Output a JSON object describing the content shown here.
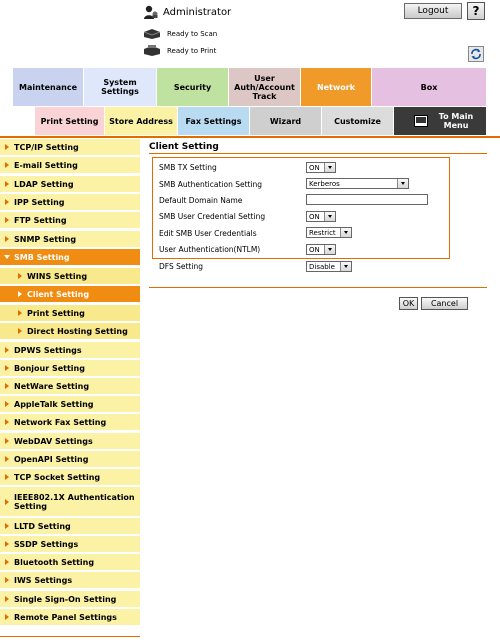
{
  "header": {
    "user": "Administrator",
    "logout_label": "Logout",
    "help_label": "?",
    "status_scan": "Ready to Scan",
    "status_print": "Ready to Print"
  },
  "tabs_row1": [
    {
      "label": "Maintenance",
      "color": "#c9d3ef"
    },
    {
      "label": "System Settings",
      "color": "#dfe8fb"
    },
    {
      "label": "Security",
      "color": "#bfe2a1"
    },
    {
      "label": "User Auth/Account Track",
      "color": "#dcc7c5"
    },
    {
      "label": "Network",
      "color": "#f09a29"
    },
    {
      "label": "Box",
      "color": "#e5c0e0"
    }
  ],
  "tabs_row2": [
    {
      "label": "Print Setting",
      "color": "#f9d3d6"
    },
    {
      "label": "Store Address",
      "color": "#fbf2a6"
    },
    {
      "label": "Fax Settings",
      "color": "#b9dbf2"
    },
    {
      "label": "Wizard",
      "color": "#cfcfcf"
    },
    {
      "label": "Customize",
      "color": "#dcdcdc"
    },
    {
      "label": "To Main Menu",
      "color": "#3a3a3a"
    }
  ],
  "sidebar": {
    "items": [
      "TCP/IP Setting",
      "E-mail Setting",
      "LDAP Setting",
      "IPP Setting",
      "FTP Setting",
      "SNMP Setting",
      "SMB Setting",
      "WINS Setting",
      "Client Setting",
      "Print Setting",
      "Direct Hosting Setting",
      "DPWS Settings",
      "Bonjour Setting",
      "NetWare Setting",
      "AppleTalk Setting",
      "Network Fax Setting",
      "WebDAV Settings",
      "OpenAPI Setting",
      "TCP Socket Setting",
      "IEEE802.1X Authentication Setting",
      "LLTD Setting",
      "SSDP Settings",
      "Bluetooth Setting",
      "IWS Settings",
      "Single Sign-On Setting",
      "Remote Panel Settings"
    ]
  },
  "panel": {
    "title": "Client Setting",
    "rows": [
      {
        "label": "SMB TX Setting",
        "value": "ON"
      },
      {
        "label": "SMB Authentication Setting",
        "value": "Kerberos"
      },
      {
        "label": "Default Domain Name",
        "value": ""
      },
      {
        "label": "SMB User Credential Setting",
        "value": "ON"
      },
      {
        "label": "Edit SMB User Credentials",
        "value": "Restrict"
      },
      {
        "label": "User Authentication(NTLM)",
        "value": "ON"
      },
      {
        "label": "DFS Setting",
        "value": "Disable"
      }
    ],
    "ok_label": "OK",
    "cancel_label": "Cancel"
  },
  "colors": {
    "accent": "#e26c00",
    "sidebar_bg": "#fbf2a6",
    "sidebar_active": "#f18c13"
  }
}
